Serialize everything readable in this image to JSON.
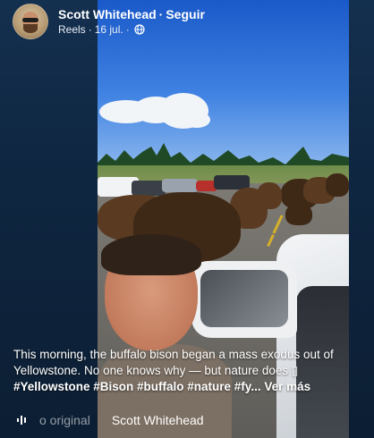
{
  "post": {
    "author": "Scott Whitehead",
    "separator": "·",
    "follow_label": "Seguir",
    "section": "Reels",
    "date": "16 jul.",
    "privacy_icon": "globe-icon"
  },
  "caption": {
    "text": "This morning, the buffalo bison began a mass exodus out of Yellowstone. No one knows why — but nature does ▯",
    "hashtags": "#Yellowstone #Bison #buffalo #nature #fy...",
    "see_more": "Ver más"
  },
  "audio": {
    "icon": "audio-wave-icon",
    "label": "o original",
    "artist": "Scott Whitehead"
  },
  "colors": {
    "background": "#0f2742",
    "text": "#ffffff"
  }
}
